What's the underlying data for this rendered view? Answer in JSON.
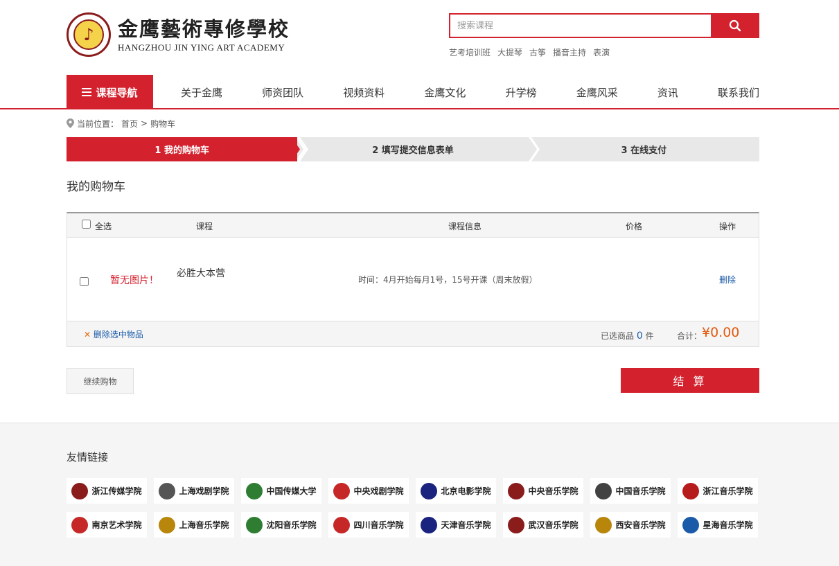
{
  "header": {
    "logo_cn": "金鹰藝術專修學校",
    "logo_en": "HANGZHOU JIN YING ART ACADEMY",
    "search_placeholder": "搜索课程",
    "hot_tags": [
      "艺考培训班",
      "大提琴",
      "古筝",
      "播音主持",
      "表演"
    ]
  },
  "nav": {
    "category_label": "课程导航",
    "items": [
      "关于金鹰",
      "师资团队",
      "视频资料",
      "金鹰文化",
      "升学榜",
      "金鹰风采",
      "资讯",
      "联系我们"
    ]
  },
  "breadcrumb": {
    "prefix": "当前位置：",
    "home": "首页",
    "sep": ">",
    "current": "购物车"
  },
  "steps": [
    "1 我的购物车",
    "2 填写提交信息表单",
    "3 在线支付"
  ],
  "cart": {
    "title": "我的购物车",
    "headers": {
      "select_all": "全选",
      "course": "课程",
      "info": "课程信息",
      "price": "价格",
      "action": "操作"
    },
    "rows": [
      {
        "no_image": "暂无图片！",
        "name": "必胜大本营",
        "info": "时间：4月开始每月1号，15号开课（周末放假）",
        "action": "删除"
      }
    ],
    "footer": {
      "delete_selected": "删除选中物品",
      "selected_label": "已选商品",
      "selected_count": "0",
      "selected_unit": "件",
      "total_label": "合计：",
      "total_value": "¥0.00"
    }
  },
  "actions": {
    "continue": "继续购物",
    "checkout": "结 算"
  },
  "friend_links": {
    "title": "友情链接",
    "items": [
      {
        "name": "浙江传媒学院",
        "color": "#8b1c1c"
      },
      {
        "name": "上海戏剧学院",
        "color": "#555555"
      },
      {
        "name": "中国传媒大学",
        "color": "#2e7d32"
      },
      {
        "name": "中央戏剧学院",
        "color": "#c62828"
      },
      {
        "name": "北京电影学院",
        "color": "#1a237e"
      },
      {
        "name": "中央音乐学院",
        "color": "#8b1c1c"
      },
      {
        "name": "中国音乐学院",
        "color": "#424242"
      },
      {
        "name": "浙江音乐学院",
        "color": "#b71c1c"
      },
      {
        "name": "南京艺术学院",
        "color": "#c62828"
      },
      {
        "name": "上海音乐学院",
        "color": "#b8860b"
      },
      {
        "name": "沈阳音乐学院",
        "color": "#2e7d32"
      },
      {
        "name": "四川音乐学院",
        "color": "#c62828"
      },
      {
        "name": "天津音乐学院",
        "color": "#1a237e"
      },
      {
        "name": "武汉音乐学院",
        "color": "#8b1c1c"
      },
      {
        "name": "西安音乐学院",
        "color": "#b8860b"
      },
      {
        "name": "星海音乐学院",
        "color": "#1a5aa8"
      }
    ]
  }
}
